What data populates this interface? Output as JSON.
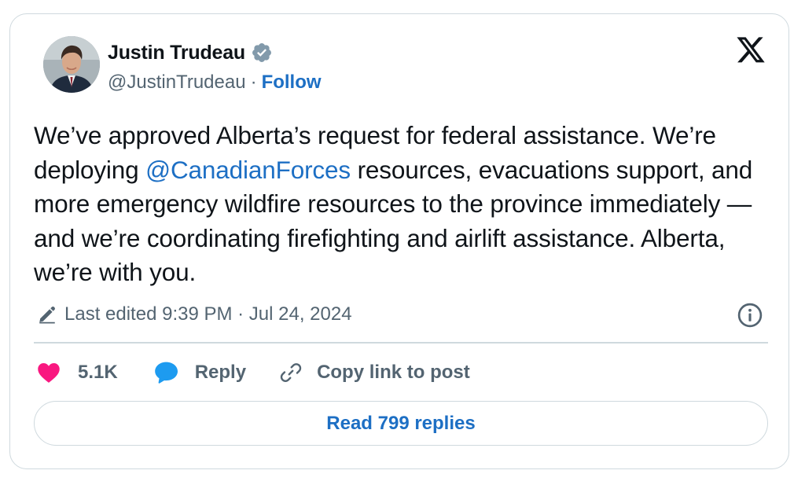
{
  "author": {
    "display_name": "Justin Trudeau",
    "handle": "@JustinTrudeau",
    "separator": "·",
    "follow_label": "Follow",
    "verified_color": "#829aab"
  },
  "tweet": {
    "text_part1": "We’ve approved Alberta’s request for federal assistance. We’re deploying ",
    "mention": "@CanadianForces",
    "text_part2": " resources, evacuations support, and more emergency wildfire resources to the province immediately — and we’re coordinating firefighting and airlift assistance. Alberta, we’re with you."
  },
  "meta": {
    "edited_label": "Last edited 9:39 PM · Jul 24, 2024"
  },
  "actions": {
    "like_count": "5.1K",
    "reply_label": "Reply",
    "copy_link_label": "Copy link to post"
  },
  "footer": {
    "read_replies_label": "Read 799 replies"
  },
  "colors": {
    "accent": "#1d6fc4",
    "like": "#f91880",
    "reply": "#1d9bf0",
    "text": "#0f1419",
    "muted": "#536471",
    "border": "#cfd9de"
  },
  "icons": [
    "avatar",
    "verified-badge-icon",
    "x-logo-icon",
    "pencil-icon",
    "info-icon",
    "heart-icon",
    "reply-bubble-icon",
    "link-icon"
  ]
}
